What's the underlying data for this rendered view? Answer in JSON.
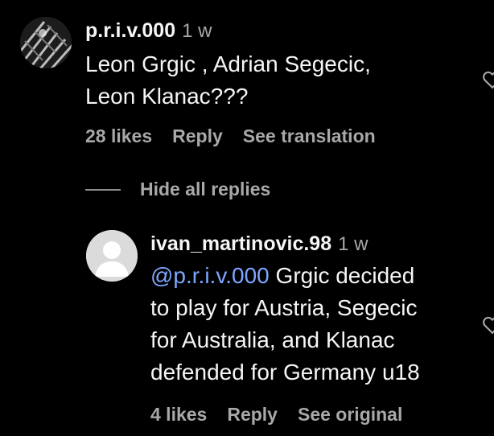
{
  "comment": {
    "username": "p.r.i.v.000",
    "time": "1 w",
    "lines": [
      "Leon Grgic , Adrian Segecic,",
      "Leon Klanac???"
    ],
    "likes": "28 likes",
    "reply": "Reply",
    "translate": "See translation"
  },
  "replies_toggle": {
    "label": "Hide all replies"
  },
  "reply": {
    "username": "ivan_martinovic.98",
    "time": "1 w",
    "mention": "@p.r.i.v.000",
    "line1_rest": " Grgic decided",
    "lines": [
      "to play for Austria, Segecic",
      "for Australia, and Klanac",
      "defended for Germany u18"
    ],
    "likes": "4 likes",
    "reply": "Reply",
    "original": "See original"
  },
  "icons": {
    "like": "heart-icon",
    "avatar_default": "default-avatar-icon"
  },
  "colors": {
    "background": "#000000",
    "text": "#f5f5f5",
    "secondary": "#a8a8a8",
    "mention": "#7ea6ff"
  }
}
